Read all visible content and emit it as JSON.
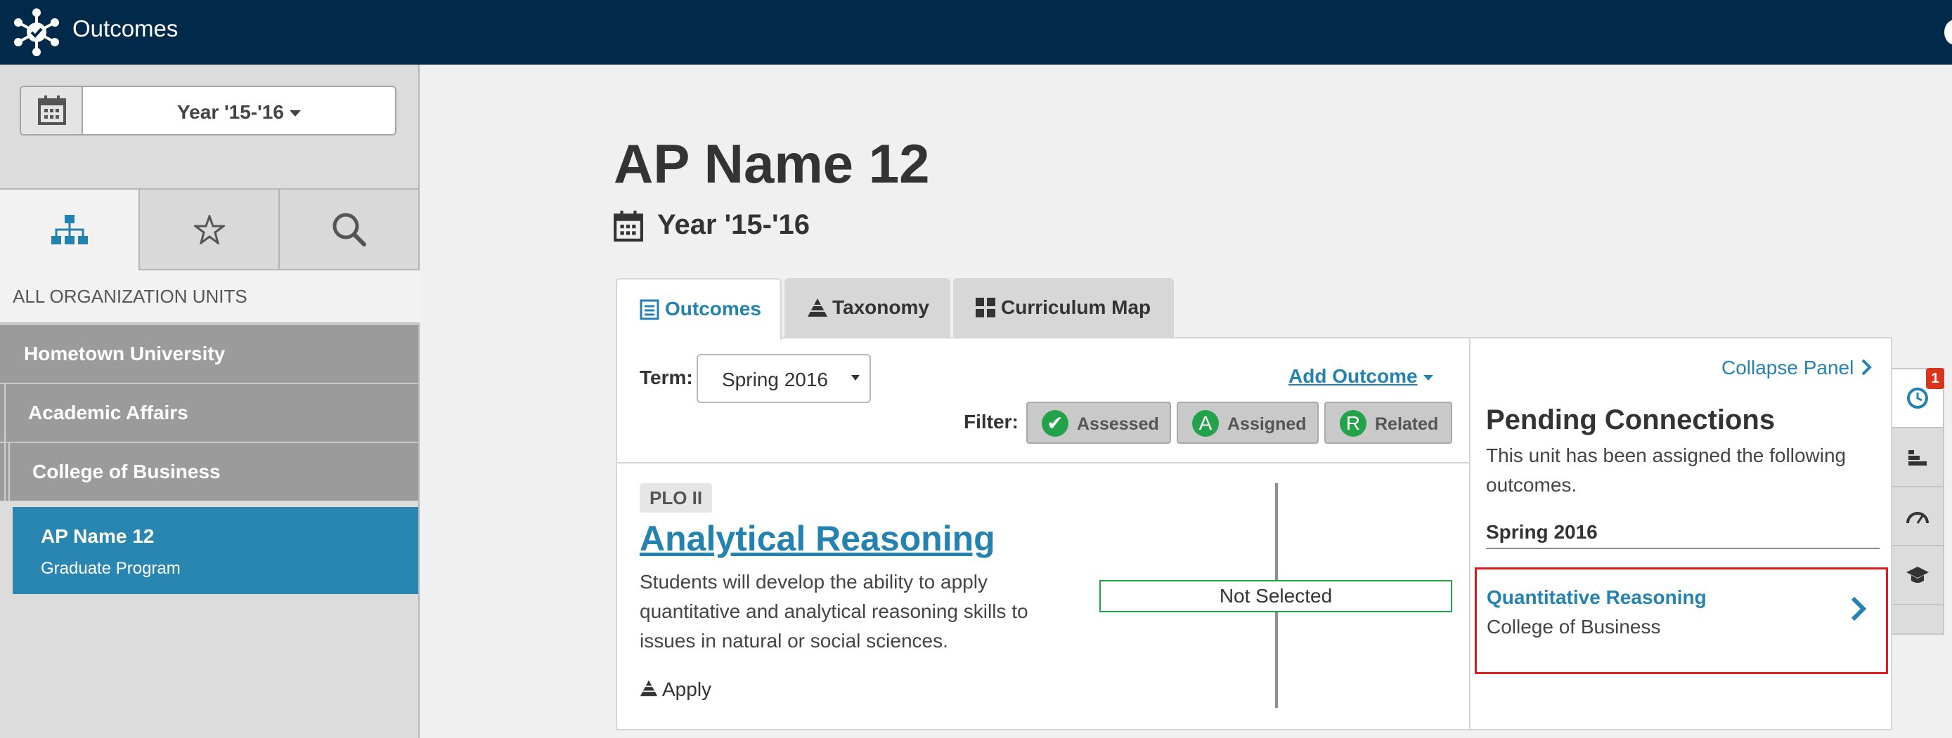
{
  "app": {
    "title": "Outcomes"
  },
  "sidebar": {
    "year_selector": {
      "label": "Year '15-'16"
    },
    "tabs": [
      {
        "icon": "hierarchy-icon",
        "active": true
      },
      {
        "icon": "star-icon",
        "active": false
      },
      {
        "icon": "search-icon",
        "active": false
      }
    ],
    "org_heading": "ALL ORGANIZATION UNITS",
    "tree": [
      {
        "label": "Hometown University"
      },
      {
        "label": "Academic Affairs"
      },
      {
        "label": "College of Business"
      }
    ],
    "active_unit": {
      "name": "AP Name 12",
      "subtitle": "Graduate Program"
    }
  },
  "main": {
    "title": "AP Name 12",
    "year": "Year '15-'16",
    "tabs": [
      {
        "label": "Outcomes",
        "icon": "list-icon",
        "active": true
      },
      {
        "label": "Taxonomy",
        "icon": "pyramid-icon",
        "active": false
      },
      {
        "label": "Curriculum Map",
        "icon": "grid-icon",
        "active": false
      }
    ],
    "term_label": "Term:",
    "term_value": "Spring 2016",
    "add_outcome": "Add Outcome",
    "filter_label": "Filter:",
    "filters": [
      {
        "label": "Assessed",
        "glyph": "✔"
      },
      {
        "label": "Assigned",
        "glyph": "A"
      },
      {
        "label": "Related",
        "glyph": "R"
      }
    ],
    "outcome": {
      "badge": "PLO II",
      "title": "Analytical Reasoning",
      "description": "Students will develop the ability to apply quantitative and analytical reasoning skills to issues in natural or social sciences.",
      "apply": "Apply",
      "status": "Not Selected"
    }
  },
  "right_panel": {
    "collapse": "Collapse Panel",
    "title": "Pending Connections",
    "description": "This unit has been assigned the following outcomes.",
    "term": "Spring 2016",
    "pending": {
      "name": "Quantitative Reasoning",
      "unit": "College of Business"
    }
  },
  "side_rail": {
    "badge_count": "1",
    "buttons": [
      "clock-icon",
      "bar-chart-icon",
      "gauge-icon",
      "graduation-cap-icon"
    ]
  },
  "colors": {
    "navy": "#012a4a",
    "accent": "#2482b0",
    "active_unit": "#2986b0",
    "green": "#22a34a",
    "highlight": "#e01d1d"
  }
}
